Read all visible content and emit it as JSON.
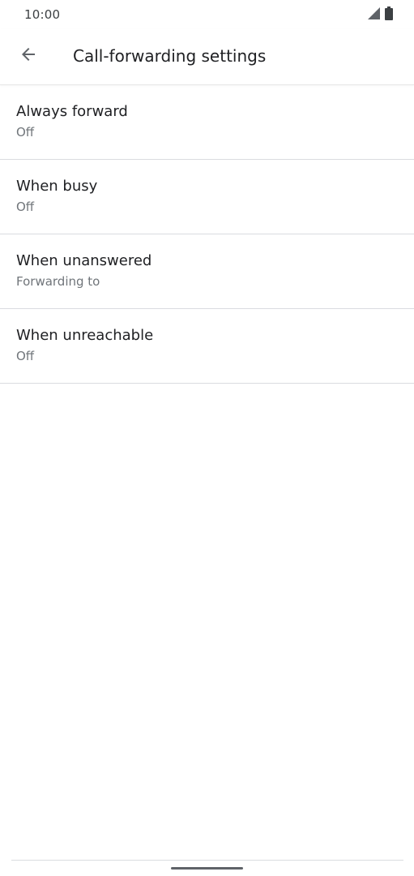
{
  "status_bar": {
    "time": "10:00",
    "icons": [
      "signal-icon",
      "battery-icon"
    ]
  },
  "app_bar": {
    "back_icon": "arrow-back-icon",
    "title": "Call-forwarding settings"
  },
  "settings": [
    {
      "title": "Always forward",
      "summary": "Off"
    },
    {
      "title": "When busy",
      "summary": "Off"
    },
    {
      "title": "When unanswered",
      "summary": "Forwarding to"
    },
    {
      "title": "When unreachable",
      "summary": "Off"
    }
  ],
  "colors": {
    "primary_text": "#202124",
    "secondary_text": "#70757a",
    "divider": "#dadce0",
    "icon": "#5f6368"
  }
}
